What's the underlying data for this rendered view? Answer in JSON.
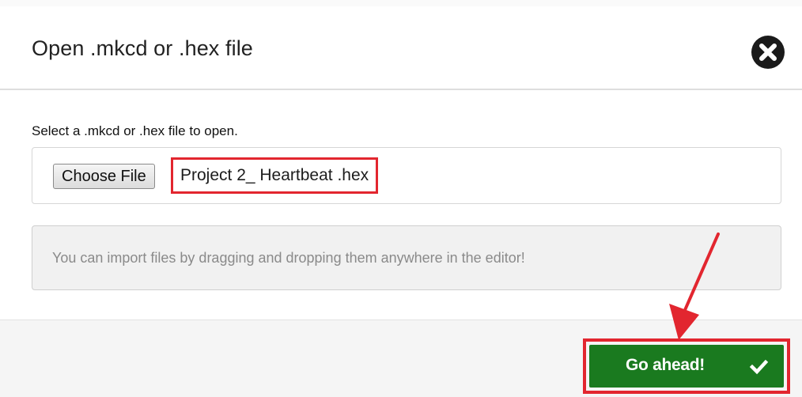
{
  "dialog": {
    "title": "Open .mkcd or .hex file",
    "close_icon": "close-x-circle-icon"
  },
  "body": {
    "prompt": "Select a .mkcd or .hex file to open.",
    "file_input": {
      "button_label": "Choose File",
      "selected_file": "Project 2_ Heartbeat .hex"
    },
    "info": "You can import files by dragging and dropping them anywhere in the editor!"
  },
  "footer": {
    "primary_button_label": "Go ahead!",
    "primary_button_icon": "checkmark-icon"
  },
  "colors": {
    "primary_green": "#1a7a1f",
    "highlight_red": "#e2262f"
  }
}
